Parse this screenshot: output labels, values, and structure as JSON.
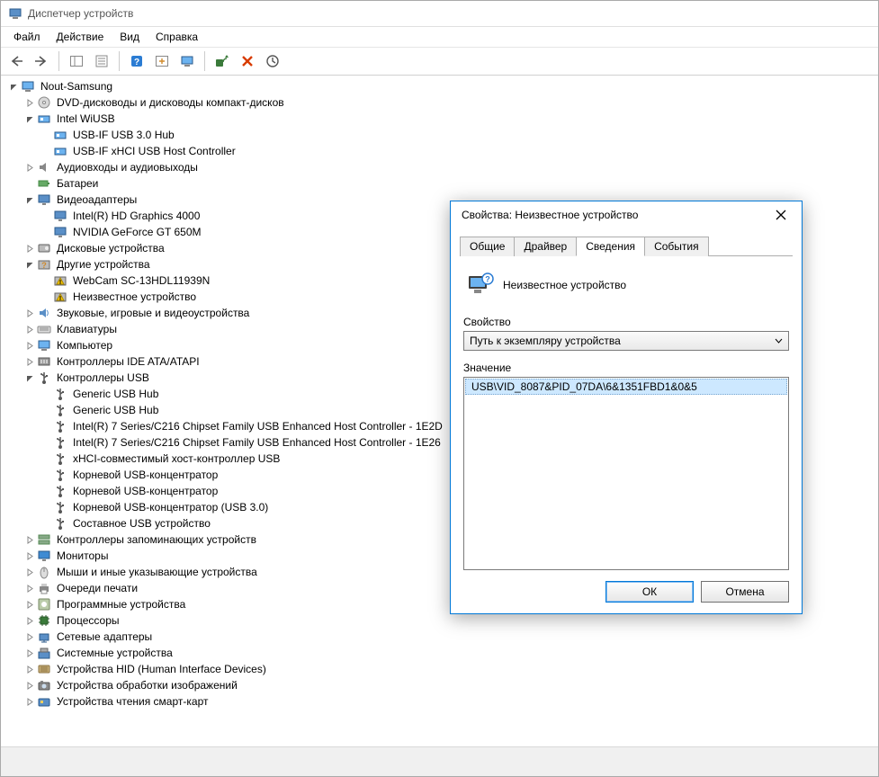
{
  "window": {
    "title": "Диспетчер устройств"
  },
  "menu": {
    "file": "Файл",
    "action": "Действие",
    "view": "Вид",
    "help": "Справка"
  },
  "tree": [
    {
      "depth": 0,
      "tw": "open",
      "icon": "computer",
      "label": "Nout-Samsung"
    },
    {
      "depth": 1,
      "tw": "closed",
      "icon": "disc",
      "label": "DVD-дисководы и дисководы компакт-дисков"
    },
    {
      "depth": 1,
      "tw": "open",
      "icon": "device",
      "label": "Intel WiUSB"
    },
    {
      "depth": 2,
      "tw": "none",
      "icon": "device",
      "label": "USB-IF USB 3.0 Hub"
    },
    {
      "depth": 2,
      "tw": "none",
      "icon": "device",
      "label": "USB-IF xHCI USB Host Controller"
    },
    {
      "depth": 1,
      "tw": "closed",
      "icon": "audio",
      "label": "Аудиовходы и аудиовыходы"
    },
    {
      "depth": 1,
      "tw": "none",
      "icon": "battery",
      "label": "Батареи"
    },
    {
      "depth": 1,
      "tw": "open",
      "icon": "display",
      "label": "Видеоадаптеры"
    },
    {
      "depth": 2,
      "tw": "none",
      "icon": "display",
      "label": "Intel(R) HD Graphics 4000"
    },
    {
      "depth": 2,
      "tw": "none",
      "icon": "display",
      "label": "NVIDIA GeForce GT 650M"
    },
    {
      "depth": 1,
      "tw": "closed",
      "icon": "disk",
      "label": "Дисковые устройства"
    },
    {
      "depth": 1,
      "tw": "open",
      "icon": "unknown",
      "label": "Другие устройства"
    },
    {
      "depth": 2,
      "tw": "none",
      "icon": "warn",
      "label": "WebCam SC-13HDL11939N"
    },
    {
      "depth": 2,
      "tw": "none",
      "icon": "warn",
      "label": "Неизвестное устройство"
    },
    {
      "depth": 1,
      "tw": "closed",
      "icon": "sound",
      "label": "Звуковые, игровые и видеоустройства"
    },
    {
      "depth": 1,
      "tw": "closed",
      "icon": "keyboard",
      "label": "Клавиатуры"
    },
    {
      "depth": 1,
      "tw": "closed",
      "icon": "computer",
      "label": "Компьютер"
    },
    {
      "depth": 1,
      "tw": "closed",
      "icon": "ide",
      "label": "Контроллеры IDE ATA/ATAPI"
    },
    {
      "depth": 1,
      "tw": "open",
      "icon": "usb",
      "label": "Контроллеры USB"
    },
    {
      "depth": 2,
      "tw": "none",
      "icon": "usb",
      "label": "Generic USB Hub"
    },
    {
      "depth": 2,
      "tw": "none",
      "icon": "usb",
      "label": "Generic USB Hub"
    },
    {
      "depth": 2,
      "tw": "none",
      "icon": "usb",
      "label": "Intel(R) 7 Series/C216 Chipset Family USB Enhanced Host Controller - 1E2D"
    },
    {
      "depth": 2,
      "tw": "none",
      "icon": "usb",
      "label": "Intel(R) 7 Series/C216 Chipset Family USB Enhanced Host Controller - 1E26"
    },
    {
      "depth": 2,
      "tw": "none",
      "icon": "usb",
      "label": "xHCI-совместимый хост-контроллер USB"
    },
    {
      "depth": 2,
      "tw": "none",
      "icon": "usb",
      "label": "Корневой USB-концентратор"
    },
    {
      "depth": 2,
      "tw": "none",
      "icon": "usb",
      "label": "Корневой USB-концентратор"
    },
    {
      "depth": 2,
      "tw": "none",
      "icon": "usb",
      "label": "Корневой USB-концентратор (USB 3.0)"
    },
    {
      "depth": 2,
      "tw": "none",
      "icon": "usb",
      "label": "Составное USB устройство"
    },
    {
      "depth": 1,
      "tw": "closed",
      "icon": "storagectl",
      "label": "Контроллеры запоминающих устройств"
    },
    {
      "depth": 1,
      "tw": "closed",
      "icon": "monitor",
      "label": "Мониторы"
    },
    {
      "depth": 1,
      "tw": "closed",
      "icon": "mouse",
      "label": "Мыши и иные указывающие устройства"
    },
    {
      "depth": 1,
      "tw": "closed",
      "icon": "printer",
      "label": "Очереди печати"
    },
    {
      "depth": 1,
      "tw": "closed",
      "icon": "software",
      "label": "Программные устройства"
    },
    {
      "depth": 1,
      "tw": "closed",
      "icon": "cpu",
      "label": "Процессоры"
    },
    {
      "depth": 1,
      "tw": "closed",
      "icon": "network",
      "label": "Сетевые адаптеры"
    },
    {
      "depth": 1,
      "tw": "closed",
      "icon": "system",
      "label": "Системные устройства"
    },
    {
      "depth": 1,
      "tw": "closed",
      "icon": "hid",
      "label": "Устройства HID (Human Interface Devices)"
    },
    {
      "depth": 1,
      "tw": "closed",
      "icon": "imaging",
      "label": "Устройства обработки изображений"
    },
    {
      "depth": 1,
      "tw": "closed",
      "icon": "smartcard",
      "label": "Устройства чтения смарт-карт"
    }
  ],
  "dialog": {
    "title": "Свойства: Неизвестное устройство",
    "tabs": {
      "general": "Общие",
      "driver": "Драйвер",
      "details": "Сведения",
      "events": "События"
    },
    "device_name": "Неизвестное устройство",
    "property_label": "Свойство",
    "property_value": "Путь к экземпляру устройства",
    "value_label": "Значение",
    "value_item": "USB\\VID_8087&PID_07DA\\6&1351FBD1&0&5",
    "ok": "ОК",
    "cancel": "Отмена"
  },
  "icons": {
    "back": "back-arrow-icon",
    "forward": "forward-arrow-icon",
    "detail": "detail-pane-icon",
    "props": "properties-icon",
    "help": "help-icon",
    "refresh": "refresh-icon",
    "monitor2": "monitor-small-icon",
    "scan": "scan-hardware-icon",
    "delete": "delete-icon",
    "update": "update-driver-icon"
  }
}
